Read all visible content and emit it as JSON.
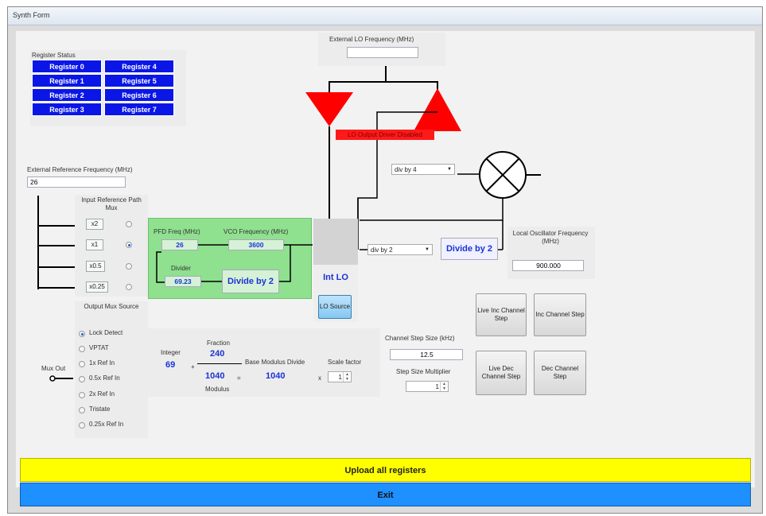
{
  "window": {
    "title": "Synth Form"
  },
  "register_status": {
    "title": "Register Status",
    "registers": [
      "Register 0",
      "Register 1",
      "Register 2",
      "Register 3",
      "Register 4",
      "Register 5",
      "Register 6",
      "Register 7"
    ]
  },
  "external_lo": {
    "label": "External LO Frequency (MHz)",
    "value": ""
  },
  "lo_output_warning": "LO Output Driver Disabled",
  "ext_ref": {
    "label": "External Reference Frequency (MHz)",
    "value": "26"
  },
  "input_ref_mux": {
    "title": "Input Reference Path Mux",
    "options": [
      "x2",
      "x1",
      "x0.5",
      "x0.25"
    ],
    "selected": 1
  },
  "pll": {
    "pfd_label": "PFD Freq (MHz)",
    "pfd_value": "26",
    "vco_label": "VCO Frequency (MHz)",
    "vco_value": "3600",
    "divider_label": "Divider",
    "divider_value": "69.23",
    "divide_label": "Divide by 2"
  },
  "int_lo": {
    "label": "Int LO",
    "source_button": "LO Source"
  },
  "div_by_4_select": "div by 4",
  "div_by_2_select": "div by 2",
  "divide_by_2_out": "Divide by 2",
  "local_osc": {
    "label": "Local Oscillator Frequency (MHz)",
    "value": "900.000"
  },
  "output_mux": {
    "title": "Output Mux Source",
    "options": [
      "Lock Detect",
      "VPTAT",
      "1x Ref In",
      "0.5x Ref In",
      "2x Ref In",
      "Tristate",
      "0.25x Ref In"
    ],
    "selected": 0,
    "mux_out_label": "Mux Out"
  },
  "fraction": {
    "integer_label": "Integer",
    "integer_value": "69",
    "plus": "+",
    "fraction_label": "Fraction",
    "fraction_value": "240",
    "modulus_value": "1040",
    "modulus_label": "Modulus",
    "equals": "=",
    "base_label": "Base Modulus Divide",
    "base_value": "1040",
    "times": "x",
    "scale_label": "Scale factor",
    "scale_value": "1"
  },
  "channel": {
    "step_label": "Channel Step Size (kHz)",
    "step_value": "12.5",
    "mult_label": "Step Size Multiplier",
    "mult_value": "1"
  },
  "buttons": {
    "live_inc": "Live Inc Channel Step",
    "inc": "Inc Channel Step",
    "live_dec": "Live Dec Channel Step",
    "dec": "Dec Channel Step",
    "upload": "Upload all registers",
    "exit": "Exit"
  },
  "colors": {
    "register_blue": "#0a16e6",
    "pll_green": "#8fe08f",
    "triangle_red": "#ff0000",
    "upload_yellow": "#ffff00",
    "exit_blue": "#1e90ff"
  }
}
